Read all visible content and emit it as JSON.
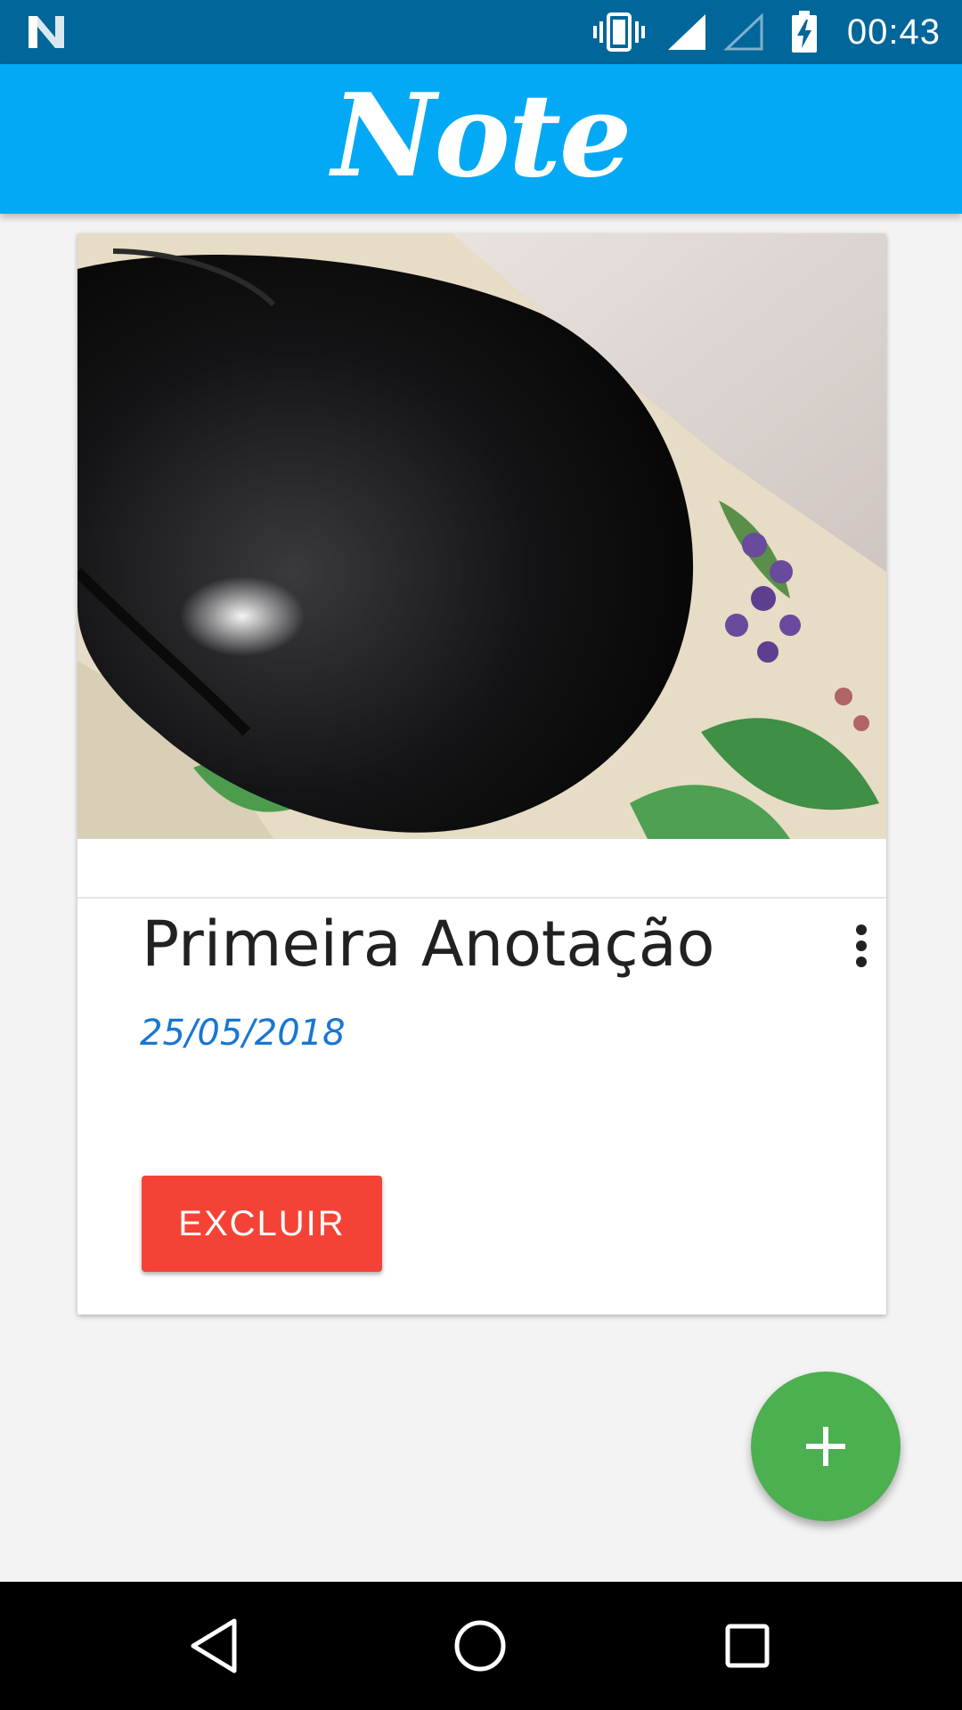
{
  "status_bar": {
    "time": "00:43",
    "icons": [
      "n-logo-icon",
      "vibrate-icon",
      "signal-full-icon",
      "signal-empty-icon",
      "battery-charging-icon"
    ]
  },
  "app_bar": {
    "title": "Note",
    "color": "#03a9f4"
  },
  "note_card": {
    "title": "Primeira Anotação",
    "date": "25/05/2018",
    "delete_label": "EXCLUIR",
    "delete_color": "#f44336",
    "date_color": "#1976d2",
    "image_description_icon": "note-photo"
  },
  "fab": {
    "icon": "plus-icon",
    "color": "#4caf50"
  },
  "nav_bar": {
    "icons": [
      "back-icon",
      "home-icon",
      "recents-icon"
    ]
  }
}
